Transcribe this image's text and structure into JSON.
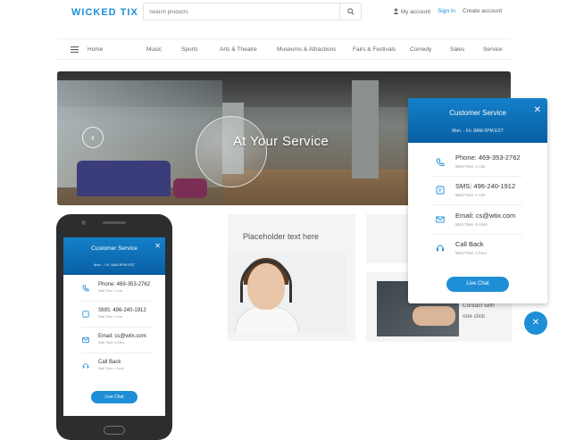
{
  "header": {
    "logo": "WICKED TIX",
    "search_placeholder": "Search products",
    "my_account": "My account",
    "sign_in": "Sign in",
    "create_account": "Create account"
  },
  "nav": {
    "items": [
      "Home",
      "Music",
      "Sports",
      "Arts & Theatre",
      "Museums & Attractions",
      "Fairs & Festivals",
      "Comedy",
      "Sales",
      "Service"
    ]
  },
  "hero": {
    "title": "At Your Service"
  },
  "cards": {
    "placeholder": "Placeholder text here",
    "caption_line1": "Contact with",
    "caption_line2": "one click"
  },
  "widget": {
    "title": "Customer Service",
    "hours": "Mon. - Fri. 8AM-5PM EST",
    "items": [
      {
        "label": "Phone: 469-353-2762",
        "sub": "Wait Time: 1 min",
        "icon": "phone-icon"
      },
      {
        "label": "SMS: 496-240-1912",
        "sub": "Wait Time: 1 min",
        "icon": "sms-icon"
      },
      {
        "label": "Email: cs@wtix.com",
        "sub": "Wait Time: 6 mins",
        "icon": "email-icon"
      },
      {
        "label": "Call Back",
        "sub": "Wait Time: 1 hour",
        "icon": "headset-icon"
      }
    ],
    "live_chat": "Live Chat"
  },
  "phone": {
    "title": "Customer Service",
    "hours": "Mon. - Fri. 8AM-5PM EST",
    "items": [
      {
        "label": "Phone: 469-353-2762",
        "sub": "Wait Time: 1 min"
      },
      {
        "label": "SMS: 496-240-1912",
        "sub": "Wait Time: 1 min"
      },
      {
        "label": "Email: cs@wtix.com",
        "sub": "Wait Time: 6 mins"
      },
      {
        "label": "Call Back",
        "sub": "Wait Time: 1 hour"
      }
    ],
    "live_chat": "Live Chat"
  },
  "colors": {
    "accent": "#1e8fd6",
    "header_blue": "#0a5fa3"
  }
}
